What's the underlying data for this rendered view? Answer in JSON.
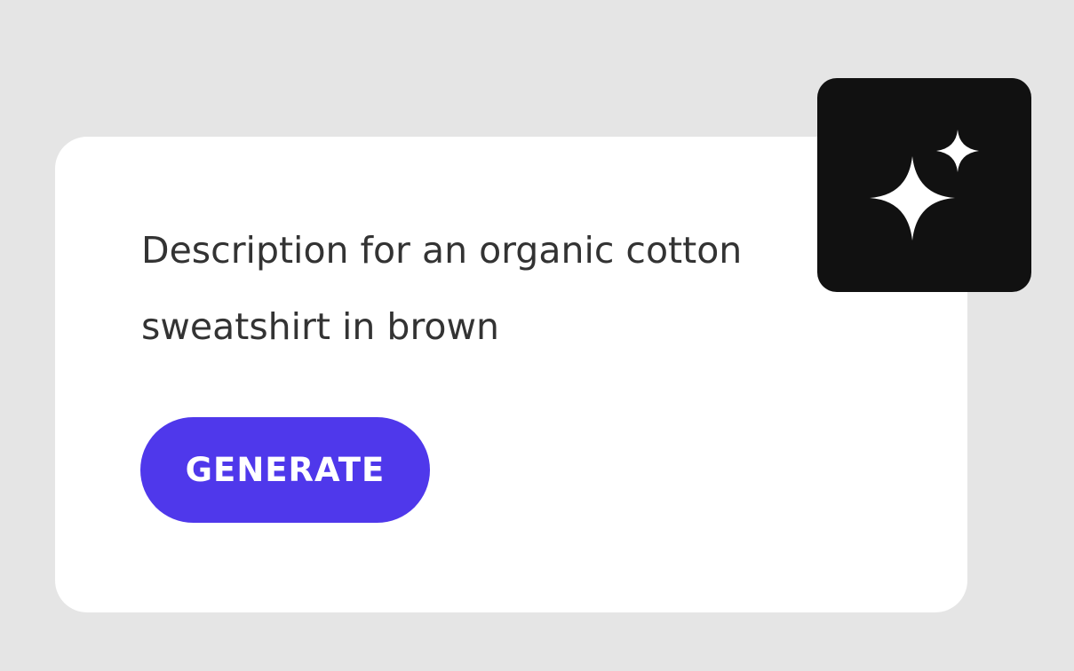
{
  "card": {
    "prompt_text": "Description for an organic cotton sweatshirt in brown",
    "generate_label": "GENERATE"
  },
  "badge": {
    "icon": "sparkles-icon"
  },
  "colors": {
    "background": "#e5e5e5",
    "card": "#ffffff",
    "text": "#333333",
    "accent": "#4f38eb",
    "badge": "#111111",
    "badge_icon": "#ffffff"
  }
}
